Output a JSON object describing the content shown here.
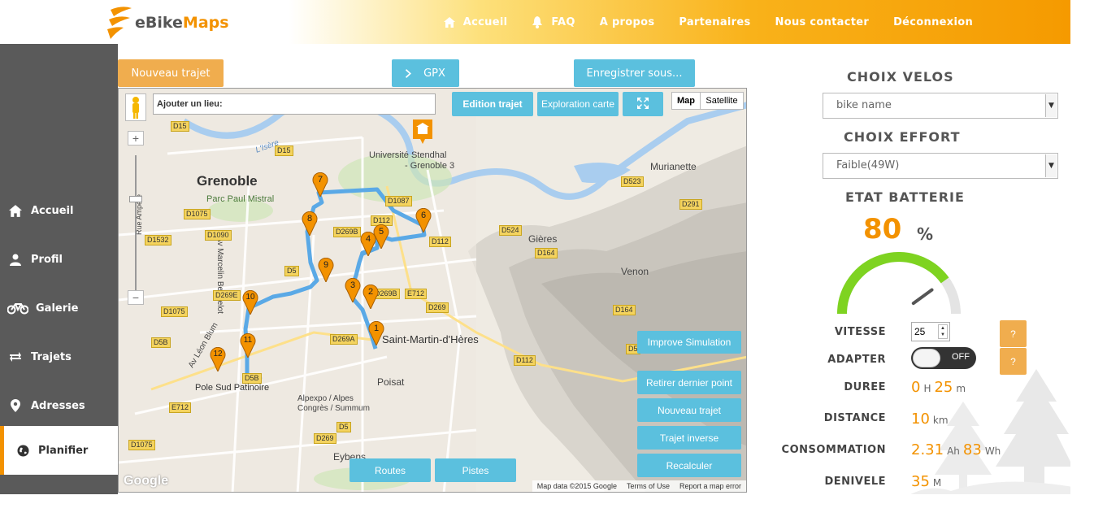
{
  "app": {
    "name_part1": "eBike",
    "name_part2": "Maps"
  },
  "nav": {
    "items": [
      {
        "label": "Accueil",
        "icon": "home-icon"
      },
      {
        "label": "FAQ",
        "icon": "bell-icon"
      },
      {
        "label": "A propos"
      },
      {
        "label": "Partenaires"
      },
      {
        "label": "Nous contacter"
      },
      {
        "label": "Déconnexion"
      }
    ]
  },
  "sidebar": {
    "items": [
      {
        "label": "Accueil",
        "icon": "home-icon"
      },
      {
        "label": "Profil",
        "icon": "user-icon"
      },
      {
        "label": "Galerie",
        "icon": "bicycle-icon"
      },
      {
        "label": "Trajets",
        "icon": "exchange-icon"
      },
      {
        "label": "Adresses",
        "icon": "map-pin-icon"
      },
      {
        "label": "Planifier",
        "icon": "globe-icon",
        "active": true
      }
    ]
  },
  "toolbar": {
    "new_trip": "Nouveau trajet",
    "gpx": "GPX",
    "save_as": "Enregistrer sous..."
  },
  "map": {
    "search_placeholder": "Ajouter un lieu:",
    "mode_edit": "Edition trajet",
    "mode_explore": "Exploration carte",
    "type_map": "Map",
    "type_satellite": "Satellite",
    "improve": "Improve Simulation",
    "remove_last": "Retirer dernier point",
    "new_trip": "Nouveau trajet",
    "reverse": "Trajet inverse",
    "recalc": "Recalculer",
    "routes": "Routes",
    "pistes": "Pistes",
    "attribution": [
      "Map data ©2015 Google",
      "Terms of Use",
      "Report a map error"
    ],
    "google": "Google",
    "labels": {
      "grenoble": "Grenoble",
      "parc": "Parc Paul Mistral",
      "universite1": "Université Stendhal",
      "universite2": "- Grenoble 3",
      "murianette": "Murianette",
      "gieres": "Gières",
      "venon": "Venon",
      "smh": "Saint-Martin-d'Hères",
      "poisat": "Poisat",
      "patinoire": "Pole Sud Patinoire",
      "alpexpo1": "Alpexpo / Alpes",
      "alpexpo2": "Congrès / Summum",
      "eybens": "Eybens",
      "berthelot": "Av Marcelin Berthelot",
      "blum": "Av Léon Blum",
      "isere": "L'Isère",
      "hue": "Rue Ampère"
    },
    "roads": [
      "D15",
      "D15",
      "D1087",
      "D112",
      "D112",
      "D269B",
      "D523",
      "D291",
      "D524",
      "D164",
      "D164",
      "D1075",
      "D1090",
      "D1532",
      "D5",
      "D269E",
      "D269B",
      "E712",
      "D269",
      "D1075",
      "D5B",
      "D269A",
      "D5B",
      "E712",
      "D5",
      "D269",
      "D1075",
      "D112",
      "D5"
    ],
    "markers": [
      "1",
      "2",
      "3",
      "4",
      "5",
      "6",
      "7",
      "8",
      "9",
      "10",
      "11",
      "12"
    ]
  },
  "panel": {
    "bike_title": "CHOIX VELOS",
    "bike_value": "bike name",
    "effort_title": "CHOIX EFFORT",
    "effort_value": "Faible(49W)",
    "battery_title": "ETAT BATTERIE",
    "battery_value": "80",
    "battery_unit": "%",
    "battery_level": 80,
    "speed_label": "VITESSE",
    "speed_value": "25",
    "adapt_label": "ADAPTER",
    "adapt_state": "OFF",
    "help": "?",
    "duration_label": "DUREE",
    "duration_h": "0",
    "duration_h_unit": "H",
    "duration_m": "25",
    "duration_m_unit": "m",
    "distance_label": "DISTANCE",
    "distance_value": "10",
    "distance_unit": "km",
    "consumption_label": "CONSOMMATION",
    "consumption_ah": "2.31",
    "consumption_ah_unit": "Ah",
    "consumption_wh": "83",
    "consumption_wh_unit": "Wh",
    "elevation_label": "DENIVELE",
    "elevation_value": "35",
    "elevation_unit": "M"
  },
  "colors": {
    "accent": "#f39200",
    "info": "#5bc0de",
    "warning": "#f0ad4e",
    "sidebar": "#5a5a5a",
    "route": "#5aa9e6",
    "gauge": "#7ed321"
  }
}
